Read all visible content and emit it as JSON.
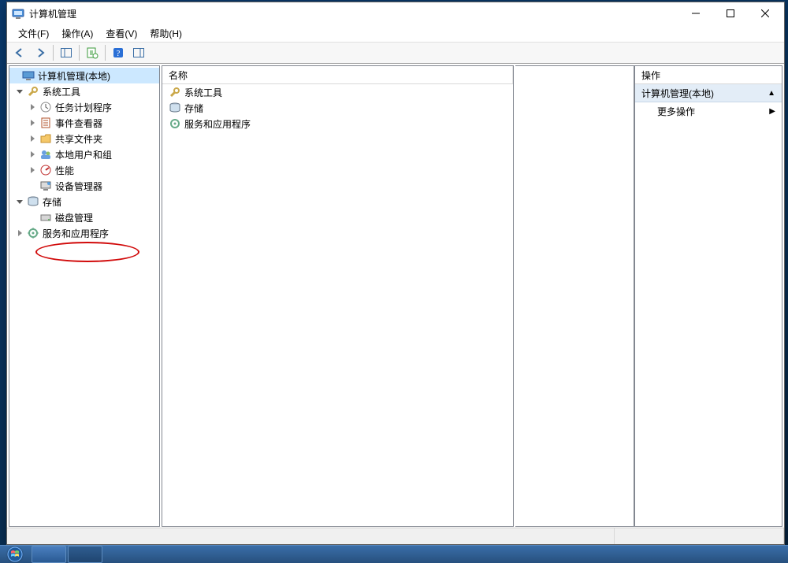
{
  "window": {
    "title": "计算机管理",
    "menus": {
      "file": "文件(F)",
      "action": "操作(A)",
      "view": "查看(V)",
      "help": "帮助(H)"
    }
  },
  "tree": {
    "root": "计算机管理(本地)",
    "sys_tools": "系统工具",
    "task_sched": "任务计划程序",
    "event_viewer": "事件查看器",
    "shared_folders": "共享文件夹",
    "local_users": "本地用户和组",
    "perf": "性能",
    "dev_mgr": "设备管理器",
    "storage": "存储",
    "disk_mgmt": "磁盘管理",
    "services_apps": "服务和应用程序"
  },
  "list": {
    "col_name": "名称",
    "items": {
      "sys_tools": "系统工具",
      "storage": "存储",
      "services_apps": "服务和应用程序"
    }
  },
  "actions": {
    "header": "操作",
    "section": "计算机管理(本地)",
    "more": "更多操作"
  }
}
